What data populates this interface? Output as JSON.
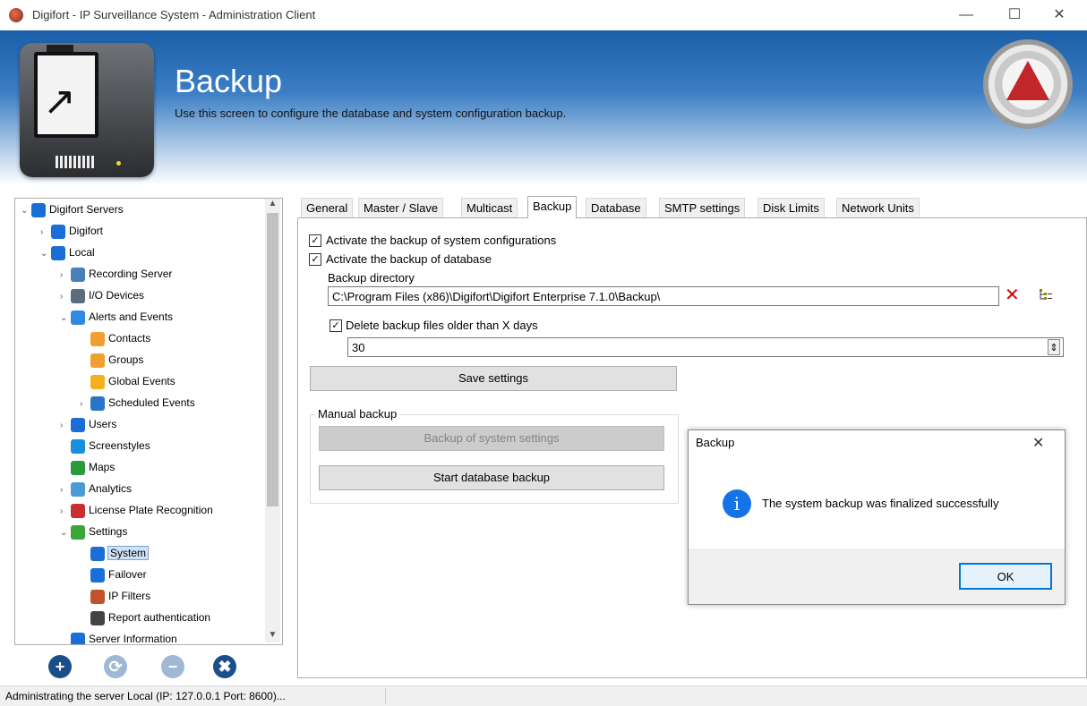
{
  "window": {
    "title": "Digifort - IP Surveillance System - Administration Client",
    "minimize": "—",
    "maximize": "☐",
    "close": "✕"
  },
  "banner": {
    "title": "Backup",
    "subtitle": "Use this screen to configure the database and system configuration backup."
  },
  "tree": {
    "expanded_glyph": "⌄",
    "collapsed_glyph": "›",
    "items": [
      {
        "label": "Digifort Servers",
        "icon": "server-icon"
      },
      {
        "label": "Digifort",
        "icon": "server-icon"
      },
      {
        "label": "Local",
        "icon": "server-icon"
      },
      {
        "label": "Recording Server",
        "icon": "recording-server-icon"
      },
      {
        "label": "I/O Devices",
        "icon": "io-device-icon"
      },
      {
        "label": "Alerts and Events",
        "icon": "alert-icon"
      },
      {
        "label": "Contacts",
        "icon": "contact-icon"
      },
      {
        "label": "Groups",
        "icon": "group-icon"
      },
      {
        "label": "Global Events",
        "icon": "global-event-icon"
      },
      {
        "label": "Scheduled Events",
        "icon": "calendar-icon"
      },
      {
        "label": "Users",
        "icon": "user-icon"
      },
      {
        "label": "Screenstyles",
        "icon": "screenstyle-icon"
      },
      {
        "label": "Maps",
        "icon": "map-icon"
      },
      {
        "label": "Analytics",
        "icon": "analytics-icon"
      },
      {
        "label": "License Plate Recognition",
        "icon": "car-icon"
      },
      {
        "label": "Settings",
        "icon": "gear-icon"
      },
      {
        "label": "System",
        "icon": "monitor-icon",
        "selected": true
      },
      {
        "label": "Failover",
        "icon": "failover-icon"
      },
      {
        "label": "IP Filters",
        "icon": "firewall-icon"
      },
      {
        "label": "Report authentication",
        "icon": "barcode-icon"
      },
      {
        "label": "Server Information",
        "icon": "server-info-icon"
      }
    ],
    "buttons": [
      {
        "name": "add",
        "glyph": "+",
        "color": "#1a4f8c"
      },
      {
        "name": "refresh",
        "glyph": "⟳",
        "color": "#9fb8d6"
      },
      {
        "name": "remove",
        "glyph": "−",
        "color": "#9fb8d6"
      },
      {
        "name": "delete",
        "glyph": "✖",
        "color": "#1a4f8c"
      }
    ]
  },
  "tabs": [
    "General",
    "Master / Slave",
    "Multicast",
    "Backup",
    "Database",
    "SMTP settings",
    "Disk Limits",
    "Network Units"
  ],
  "active_tab": "Backup",
  "backup": {
    "activate_system_config_label": "Activate the backup of system configurations",
    "activate_system_config_checked": true,
    "activate_database_label": "Activate the backup of database",
    "activate_database_checked": true,
    "directory_label": "Backup directory",
    "directory_value": "C:\\Program Files (x86)\\Digifort\\Digifort Enterprise 7.1.0\\Backup\\",
    "delete_old_label": "Delete backup files older than X days",
    "delete_old_checked": true,
    "days_value": "30",
    "save_button": "Save settings",
    "manual_group_label": "Manual backup",
    "system_settings_button": "Backup of system settings",
    "database_backup_button": "Start database backup",
    "check_glyph": "✓",
    "clear_glyph": "✕",
    "spin_glyph": "⇕"
  },
  "dialog": {
    "title": "Backup",
    "close": "✕",
    "message": "The system backup was finalized successfully",
    "icon_glyph": "i",
    "ok_button": "OK"
  },
  "status": {
    "text": "Administrating the server Local (IP: 127.0.0.1 Port: 8600)..."
  },
  "colors": {
    "banner_top": "#1a5fa8",
    "selection": "#cfe3f7",
    "accent_blue": "#1473e6",
    "logo_red": "#c0262a"
  }
}
